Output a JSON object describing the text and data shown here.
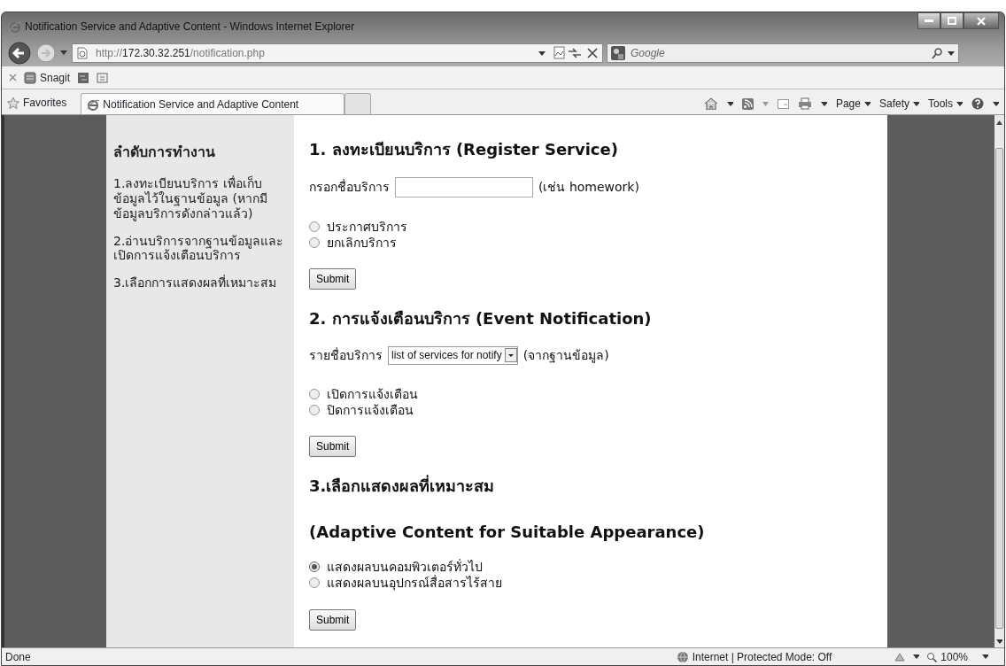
{
  "window": {
    "title": "Notification Service and Adaptive Content - Windows Internet Explorer"
  },
  "address_bar": {
    "url_prefix": "http://",
    "url_host": "172.30.32.251",
    "url_path": "/notification.php",
    "search_placeholder": "Google"
  },
  "links_bar": {
    "items": [
      {
        "label": "Snagit",
        "kind": "labeled"
      },
      {
        "kind": "icon"
      }
    ]
  },
  "favorites_bar": {
    "label": "Favorites",
    "tabs": [
      {
        "title": "Notification Service and Adaptive Content",
        "selected": true
      }
    ]
  },
  "command_bar": {
    "menus": [
      "Page",
      "Safety",
      "Tools"
    ]
  },
  "sidebar": {
    "heading": "ลำดับการทำงาน",
    "items": [
      "1.ลงทะเบียนบริการ เพื่อเก็บข้อมูลไว้ในฐานข้อมูล (หากมีข้อมูลบริการดังกล่าวแล้ว)",
      "2.อ่านบริการจากฐานข้อมูลและเปิดการแจ้งเตือนบริการ",
      "3.เลือกการแสดงผลที่เหมาะสม"
    ]
  },
  "sections": [
    {
      "headings": [
        "1. ลงทะเบียนบริการ (Register Service)"
      ],
      "field": {
        "kind": "text",
        "label": "กรอกชื่อบริการ",
        "note": "(เช่น homework)"
      },
      "options": [
        {
          "label": "ประกาศบริการ",
          "selected": false
        },
        {
          "label": "ยกเลิกบริการ",
          "selected": false
        }
      ],
      "button": "Submit"
    },
    {
      "headings": [
        "2. การแจ้งเตือนบริการ (Event Notification)"
      ],
      "field": {
        "kind": "select",
        "label": "รายชื่อบริการ",
        "value": "list of services for notify",
        "note": "(จากฐานข้อมูล)"
      },
      "options": [
        {
          "label": "เปิดการแจ้งเตือน",
          "selected": false
        },
        {
          "label": "ปิดการแจ้งเตือน",
          "selected": false
        }
      ],
      "button": "Submit"
    },
    {
      "headings": [
        "3.เลือกแสดงผลที่เหมาะสม",
        "(Adaptive Content for Suitable Appearance)"
      ],
      "options": [
        {
          "label": "แสดงผลบนคอมพิวเตอร์ทั่วไป",
          "selected": true
        },
        {
          "label": "แสดงผลบนอุปกรณ์สื่อสารไร้สาย",
          "selected": false
        }
      ],
      "button": "Submit"
    }
  ],
  "status_bar": {
    "text": "Done",
    "zone": "Internet | Protected Mode: Off",
    "zoom": "100%"
  }
}
